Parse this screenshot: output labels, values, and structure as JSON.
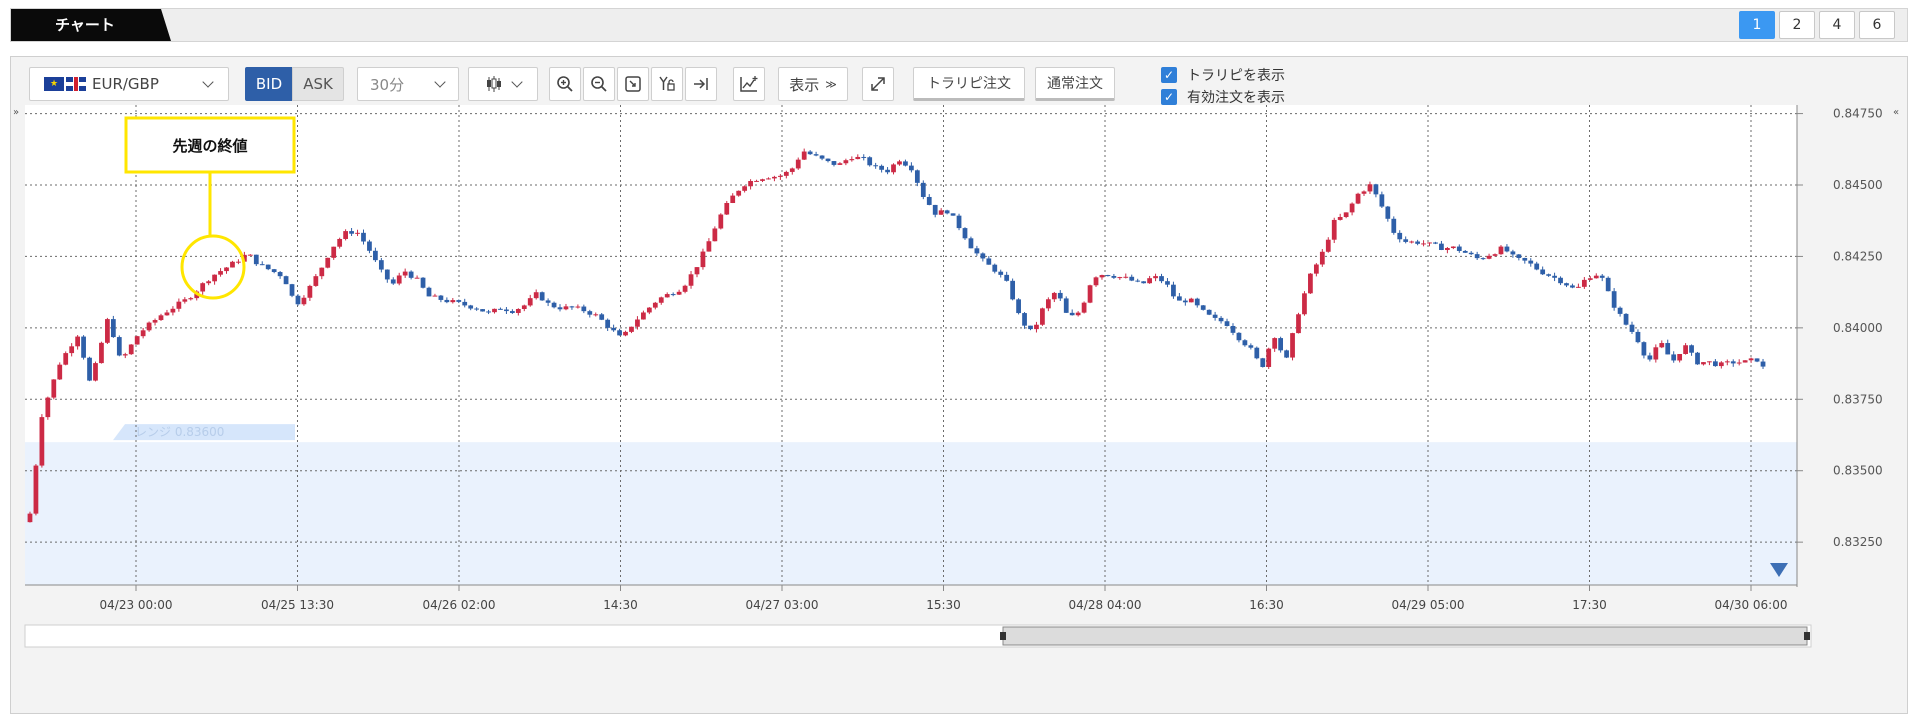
{
  "header": {
    "tab_label": "チャート",
    "layouts": [
      "1",
      "2",
      "4",
      "6"
    ],
    "active_layout": "1"
  },
  "toolbar": {
    "symbol": "EUR/GBP",
    "bid_label": "BID",
    "ask_label": "ASK",
    "interval": "30分",
    "display_label": "表示",
    "trail_order_label": "トラリピ注文",
    "normal_order_label": "通常注文",
    "show_trail_label": "トラリピを表示",
    "show_orders_label": "有効注文を表示",
    "icons": [
      "zoom-in-icon",
      "zoom-out-icon",
      "fit-icon",
      "y-axis-lock-icon",
      "scroll-end-icon",
      "indicator-icon",
      "fullscreen-icon"
    ]
  },
  "annotation": {
    "text": "先週の終値",
    "color": "#ffe600"
  },
  "range_band": {
    "label": "レンジ 0.83600",
    "top": 0.836,
    "color": "#eaf2fd"
  },
  "colors": {
    "up": "#cc2a45",
    "down": "#2e5fa8",
    "grid": "#6b6b6b"
  },
  "chart_data": {
    "type": "candlestick",
    "y_ticks": [
      "0.84750",
      "0.84500",
      "0.84250",
      "0.84000",
      "0.83750",
      "0.83500",
      "0.83250"
    ],
    "ylim": [
      0.831,
      0.8478
    ],
    "x_ticks": [
      "04/23 00:00",
      "04/25 13:30",
      "04/26 02:00",
      "14:30",
      "04/27 03:00",
      "15:30",
      "04/28 04:00",
      "16:30",
      "04/29 05:00",
      "17:30",
      "04/30 06:00"
    ],
    "grid": true,
    "close_path": [
      [
        0,
        0.8335
      ],
      [
        2,
        0.837
      ],
      [
        5,
        0.8388
      ],
      [
        8,
        0.8398
      ],
      [
        10,
        0.838
      ],
      [
        13,
        0.8404
      ],
      [
        15,
        0.8388
      ],
      [
        18,
        0.8398
      ],
      [
        22,
        0.8405
      ],
      [
        26,
        0.841
      ],
      [
        30,
        0.8418
      ],
      [
        34,
        0.8423
      ],
      [
        36,
        0.8426
      ],
      [
        38,
        0.8422
      ],
      [
        40,
        0.842
      ],
      [
        42,
        0.8418
      ],
      [
        44,
        0.8408
      ],
      [
        46,
        0.8413
      ],
      [
        48,
        0.842
      ],
      [
        50,
        0.8428
      ],
      [
        52,
        0.8433
      ],
      [
        54,
        0.8434
      ],
      [
        56,
        0.8428
      ],
      [
        58,
        0.842
      ],
      [
        60,
        0.8415
      ],
      [
        62,
        0.842
      ],
      [
        64,
        0.8417
      ],
      [
        66,
        0.8411
      ],
      [
        68,
        0.841
      ],
      [
        70,
        0.8409
      ],
      [
        72,
        0.8408
      ],
      [
        74,
        0.8407
      ],
      [
        76,
        0.8405
      ],
      [
        78,
        0.8407
      ],
      [
        80,
        0.8406
      ],
      [
        82,
        0.8408
      ],
      [
        84,
        0.8412
      ],
      [
        86,
        0.8408
      ],
      [
        88,
        0.8407
      ],
      [
        90,
        0.8407
      ],
      [
        92,
        0.8406
      ],
      [
        94,
        0.8404
      ],
      [
        96,
        0.84
      ],
      [
        98,
        0.8396
      ],
      [
        100,
        0.8402
      ],
      [
        102,
        0.8406
      ],
      [
        104,
        0.841
      ],
      [
        106,
        0.8412
      ],
      [
        108,
        0.8414
      ],
      [
        110,
        0.842
      ],
      [
        112,
        0.8428
      ],
      [
        114,
        0.8438
      ],
      [
        116,
        0.8445
      ],
      [
        118,
        0.845
      ],
      [
        120,
        0.8452
      ],
      [
        122,
        0.8453
      ],
      [
        124,
        0.8453
      ],
      [
        126,
        0.8455
      ],
      [
        128,
        0.8462
      ],
      [
        130,
        0.846
      ],
      [
        132,
        0.8458
      ],
      [
        134,
        0.8457
      ],
      [
        136,
        0.846
      ],
      [
        138,
        0.8459
      ],
      [
        140,
        0.8456
      ],
      [
        142,
        0.8455
      ],
      [
        144,
        0.8459
      ],
      [
        146,
        0.8456
      ],
      [
        148,
        0.8446
      ],
      [
        150,
        0.844
      ],
      [
        152,
        0.8441
      ],
      [
        154,
        0.8435
      ],
      [
        156,
        0.8428
      ],
      [
        158,
        0.8423
      ],
      [
        160,
        0.842
      ],
      [
        162,
        0.8415
      ],
      [
        164,
        0.8403
      ],
      [
        166,
        0.8398
      ],
      [
        168,
        0.8408
      ],
      [
        170,
        0.8413
      ],
      [
        172,
        0.8403
      ],
      [
        174,
        0.8406
      ],
      [
        176,
        0.8418
      ],
      [
        178,
        0.8419
      ],
      [
        180,
        0.8418
      ],
      [
        182,
        0.8417
      ],
      [
        184,
        0.8415
      ],
      [
        186,
        0.8418
      ],
      [
        188,
        0.8416
      ],
      [
        190,
        0.8409
      ],
      [
        192,
        0.841
      ],
      [
        194,
        0.8406
      ],
      [
        196,
        0.8403
      ],
      [
        198,
        0.8402
      ],
      [
        200,
        0.8397
      ],
      [
        202,
        0.8393
      ],
      [
        204,
        0.8386
      ],
      [
        206,
        0.8398
      ],
      [
        208,
        0.8388
      ],
      [
        210,
        0.8405
      ],
      [
        212,
        0.8418
      ],
      [
        214,
        0.8426
      ],
      [
        216,
        0.8437
      ],
      [
        218,
        0.844
      ],
      [
        220,
        0.8447
      ],
      [
        222,
        0.845
      ],
      [
        224,
        0.8442
      ],
      [
        226,
        0.8433
      ],
      [
        228,
        0.843
      ],
      [
        230,
        0.843
      ],
      [
        232,
        0.8429
      ],
      [
        234,
        0.8428
      ],
      [
        236,
        0.8428
      ],
      [
        238,
        0.8426
      ],
      [
        240,
        0.8424
      ],
      [
        242,
        0.8426
      ],
      [
        244,
        0.8428
      ],
      [
        246,
        0.8424
      ],
      [
        248,
        0.8423
      ],
      [
        250,
        0.842
      ],
      [
        252,
        0.8418
      ],
      [
        254,
        0.8416
      ],
      [
        256,
        0.8413
      ],
      [
        258,
        0.8418
      ],
      [
        260,
        0.8419
      ],
      [
        262,
        0.8409
      ],
      [
        264,
        0.8402
      ],
      [
        266,
        0.8397
      ],
      [
        268,
        0.8388
      ],
      [
        270,
        0.8395
      ],
      [
        272,
        0.8388
      ],
      [
        274,
        0.8394
      ],
      [
        276,
        0.8388
      ],
      [
        278,
        0.8388
      ],
      [
        280,
        0.8387
      ],
      [
        282,
        0.8388
      ],
      [
        284,
        0.8388
      ],
      [
        286,
        0.8389
      ],
      [
        288,
        0.8383
      ]
    ]
  }
}
